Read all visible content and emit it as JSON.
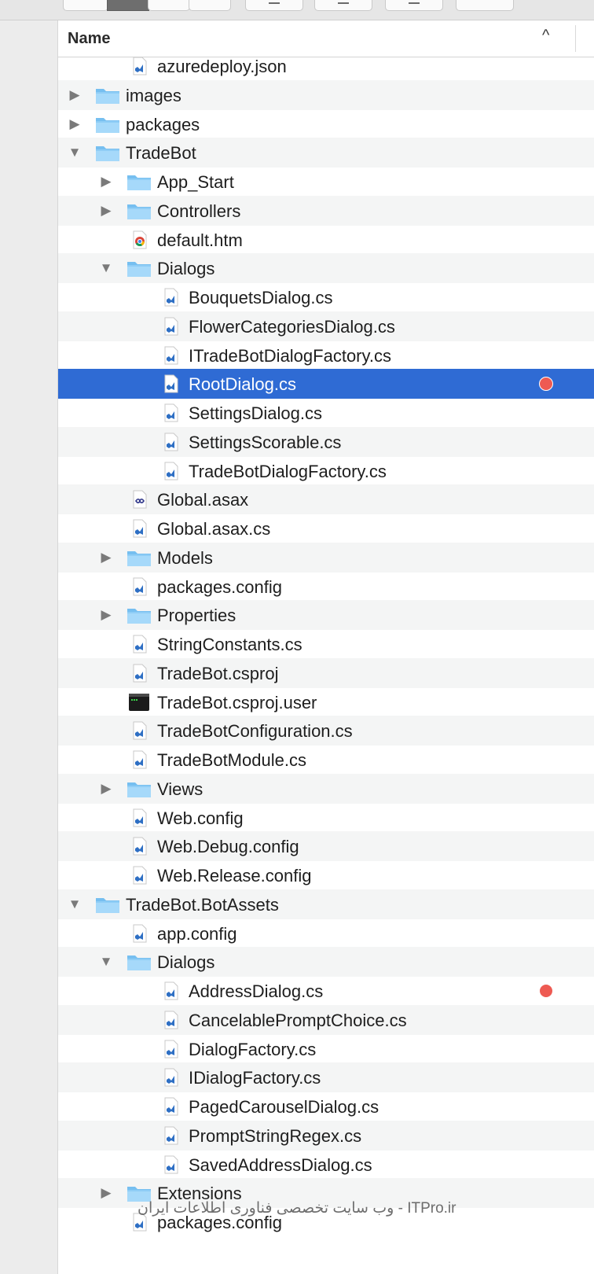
{
  "header": {
    "name_column": "Name",
    "sort_indicator": "^"
  },
  "colors": {
    "selection": "#2f6bd4",
    "badge": "#ee5a52",
    "folder": "#7ec6f4",
    "alt_row": "#f4f5f5"
  },
  "rows": [
    {
      "label": "azuredeploy.json",
      "depth": 1,
      "icon": "vs-csharp-icon",
      "disclosure": "none",
      "partial": true
    },
    {
      "label": "images",
      "depth": 0,
      "icon": "folder-icon",
      "disclosure": "collapsed"
    },
    {
      "label": "packages",
      "depth": 0,
      "icon": "folder-icon",
      "disclosure": "collapsed"
    },
    {
      "label": "TradeBot",
      "depth": 0,
      "icon": "folder-icon",
      "disclosure": "expanded"
    },
    {
      "label": "App_Start",
      "depth": 1,
      "icon": "folder-icon",
      "disclosure": "collapsed"
    },
    {
      "label": "Controllers",
      "depth": 1,
      "icon": "folder-icon",
      "disclosure": "collapsed"
    },
    {
      "label": "default.htm",
      "depth": 1,
      "icon": "chrome-document-icon",
      "disclosure": "none"
    },
    {
      "label": "Dialogs",
      "depth": 1,
      "icon": "folder-icon",
      "disclosure": "expanded"
    },
    {
      "label": "BouquetsDialog.cs",
      "depth": 2,
      "icon": "vs-csharp-icon",
      "disclosure": "none"
    },
    {
      "label": "FlowerCategoriesDialog.cs",
      "depth": 2,
      "icon": "vs-csharp-icon",
      "disclosure": "none"
    },
    {
      "label": "ITradeBotDialogFactory.cs",
      "depth": 2,
      "icon": "vs-csharp-icon",
      "disclosure": "none"
    },
    {
      "label": "RootDialog.cs",
      "depth": 2,
      "icon": "vs-csharp-icon",
      "disclosure": "none",
      "selected": true,
      "tag": "red"
    },
    {
      "label": "SettingsDialog.cs",
      "depth": 2,
      "icon": "vs-csharp-icon",
      "disclosure": "none"
    },
    {
      "label": "SettingsScorable.cs",
      "depth": 2,
      "icon": "vs-csharp-icon",
      "disclosure": "none"
    },
    {
      "label": "TradeBotDialogFactory.cs",
      "depth": 2,
      "icon": "vs-csharp-icon",
      "disclosure": "none"
    },
    {
      "label": "Global.asax",
      "depth": 1,
      "icon": "asax-document-icon",
      "disclosure": "none"
    },
    {
      "label": "Global.asax.cs",
      "depth": 1,
      "icon": "vs-csharp-icon",
      "disclosure": "none"
    },
    {
      "label": "Models",
      "depth": 1,
      "icon": "folder-icon",
      "disclosure": "collapsed"
    },
    {
      "label": "packages.config",
      "depth": 1,
      "icon": "vs-csharp-icon",
      "disclosure": "none"
    },
    {
      "label": "Properties",
      "depth": 1,
      "icon": "folder-icon",
      "disclosure": "collapsed"
    },
    {
      "label": "StringConstants.cs",
      "depth": 1,
      "icon": "vs-csharp-icon",
      "disclosure": "none"
    },
    {
      "label": "TradeBot.csproj",
      "depth": 1,
      "icon": "vs-csharp-icon",
      "disclosure": "none"
    },
    {
      "label": "TradeBot.csproj.user",
      "depth": 1,
      "icon": "terminal-icon",
      "disclosure": "none"
    },
    {
      "label": "TradeBotConfiguration.cs",
      "depth": 1,
      "icon": "vs-csharp-icon",
      "disclosure": "none"
    },
    {
      "label": "TradeBotModule.cs",
      "depth": 1,
      "icon": "vs-csharp-icon",
      "disclosure": "none"
    },
    {
      "label": "Views",
      "depth": 1,
      "icon": "folder-icon",
      "disclosure": "collapsed"
    },
    {
      "label": "Web.config",
      "depth": 1,
      "icon": "vs-csharp-icon",
      "disclosure": "none"
    },
    {
      "label": "Web.Debug.config",
      "depth": 1,
      "icon": "vs-csharp-icon",
      "disclosure": "none"
    },
    {
      "label": "Web.Release.config",
      "depth": 1,
      "icon": "vs-csharp-icon",
      "disclosure": "none"
    },
    {
      "label": "TradeBot.BotAssets",
      "depth": 0,
      "icon": "folder-icon",
      "disclosure": "expanded"
    },
    {
      "label": "app.config",
      "depth": 1,
      "icon": "vs-csharp-icon",
      "disclosure": "none"
    },
    {
      "label": "Dialogs",
      "depth": 1,
      "icon": "folder-icon",
      "disclosure": "expanded"
    },
    {
      "label": "AddressDialog.cs",
      "depth": 2,
      "icon": "vs-csharp-icon",
      "disclosure": "none",
      "tag": "red"
    },
    {
      "label": "CancelablePromptChoice.cs",
      "depth": 2,
      "icon": "vs-csharp-icon",
      "disclosure": "none"
    },
    {
      "label": "DialogFactory.cs",
      "depth": 2,
      "icon": "vs-csharp-icon",
      "disclosure": "none"
    },
    {
      "label": "IDialogFactory.cs",
      "depth": 2,
      "icon": "vs-csharp-icon",
      "disclosure": "none"
    },
    {
      "label": "PagedCarouselDialog.cs",
      "depth": 2,
      "icon": "vs-csharp-icon",
      "disclosure": "none"
    },
    {
      "label": "PromptStringRegex.cs",
      "depth": 2,
      "icon": "vs-csharp-icon",
      "disclosure": "none"
    },
    {
      "label": "SavedAddressDialog.cs",
      "depth": 2,
      "icon": "vs-csharp-icon",
      "disclosure": "none"
    },
    {
      "label": "Extensions",
      "depth": 1,
      "icon": "folder-icon",
      "disclosure": "collapsed"
    },
    {
      "label": "packages.config",
      "depth": 1,
      "icon": "vs-csharp-icon",
      "disclosure": "none"
    }
  ],
  "watermark": "ITPro.ir - وب سایت تخصصی فناوری اطلاعات ایران"
}
